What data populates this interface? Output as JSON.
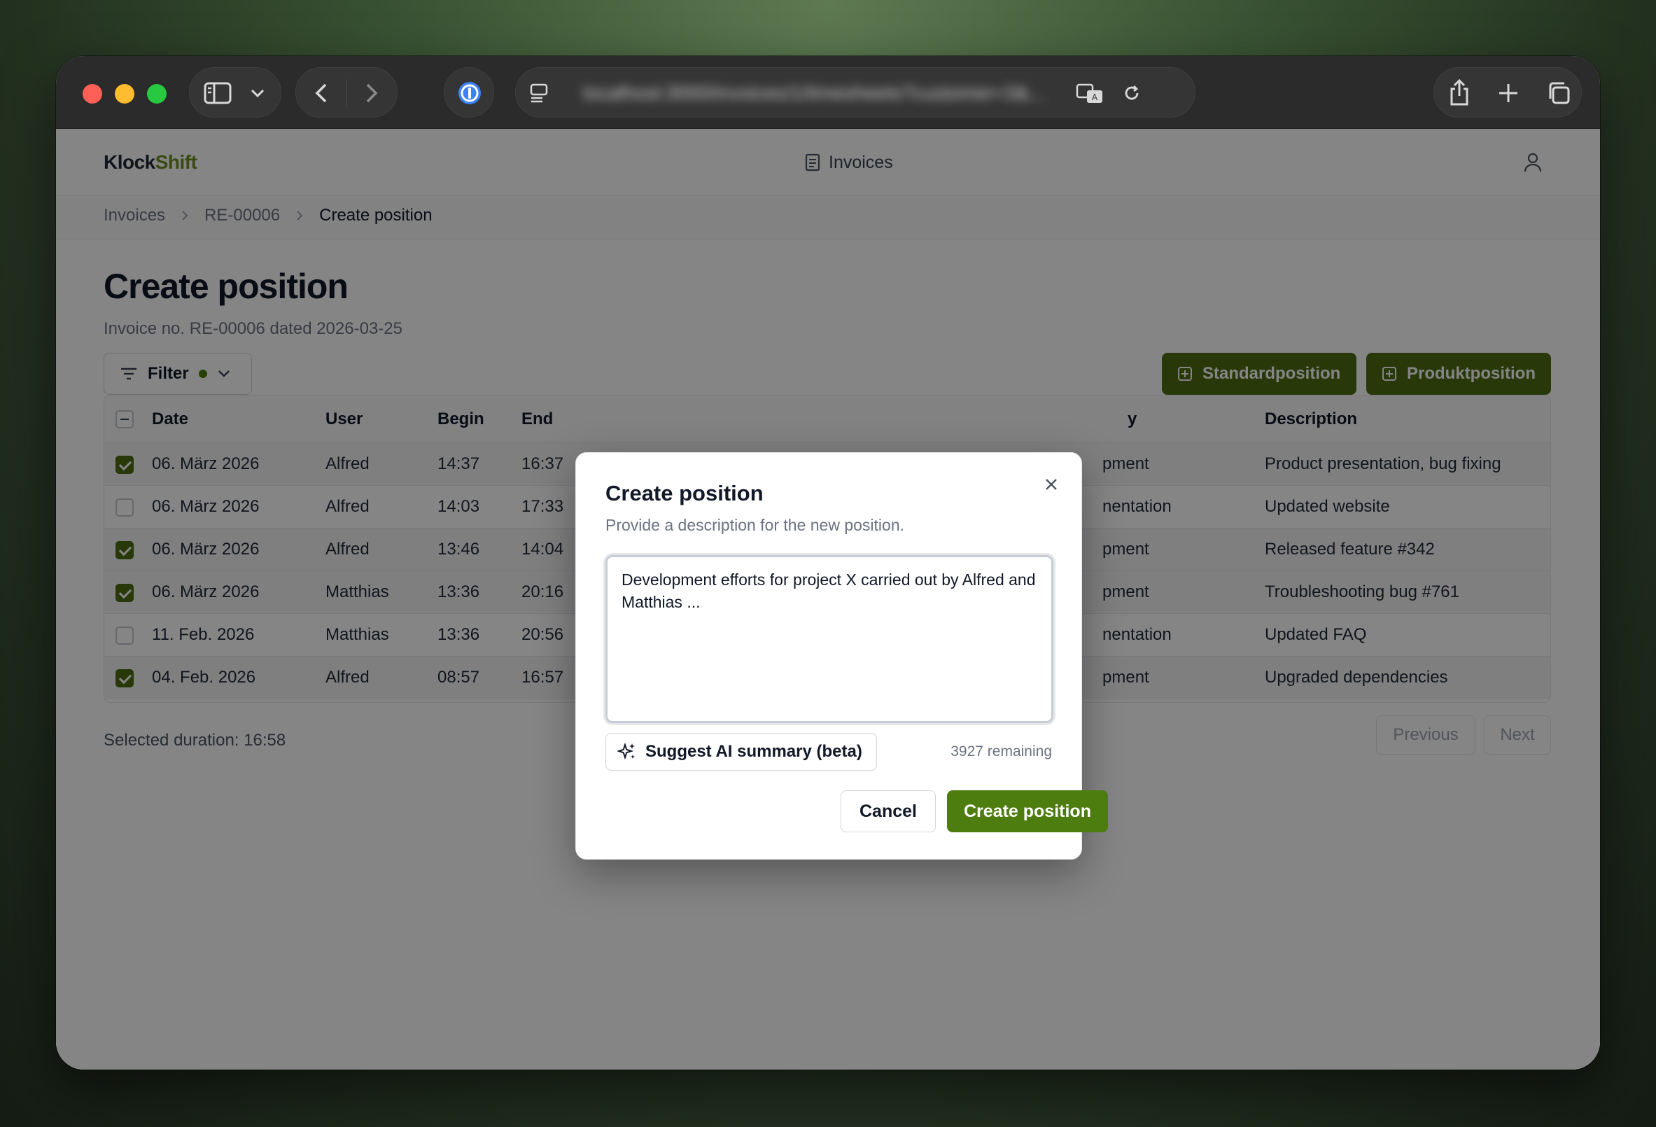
{
  "browser": {
    "url": "localhost:3000/invoices/1/timesheets?customer=3&..."
  },
  "app": {
    "logo_part1": "Klock",
    "logo_part2": "Shift",
    "nav_invoices": "Invoices",
    "accent": "#4d7c0f"
  },
  "breadcrumb": [
    "Invoices",
    "RE-00006",
    "Create position"
  ],
  "page": {
    "title": "Create position",
    "subtitle": "Invoice no. RE-00006 dated 2026-03-25",
    "filter_label": "Filter",
    "standard_btn": "Standardposition",
    "product_btn": "Produktposition"
  },
  "table": {
    "headers": [
      "Date",
      "User",
      "Begin",
      "End",
      "y",
      "Description"
    ],
    "rows": [
      {
        "checked": true,
        "date": "06. März 2026",
        "user": "Alfred",
        "begin": "14:37",
        "end": "16:37",
        "category": "pment",
        "description": "Product presentation, bug fixing"
      },
      {
        "checked": false,
        "date": "06. März 2026",
        "user": "Alfred",
        "begin": "14:03",
        "end": "17:33",
        "category": "nentation",
        "description": "Updated website"
      },
      {
        "checked": true,
        "date": "06. März 2026",
        "user": "Alfred",
        "begin": "13:46",
        "end": "14:04",
        "category": "pment",
        "description": "Released feature #342"
      },
      {
        "checked": true,
        "date": "06. März 2026",
        "user": "Matthias",
        "begin": "13:36",
        "end": "20:16",
        "category": "pment",
        "description": "Troubleshooting bug #761"
      },
      {
        "checked": false,
        "date": "11. Feb. 2026",
        "user": "Matthias",
        "begin": "13:36",
        "end": "20:56",
        "category": "nentation",
        "description": "Updated FAQ"
      },
      {
        "checked": true,
        "date": "04. Feb. 2026",
        "user": "Alfred",
        "begin": "08:57",
        "end": "16:57",
        "category": "pment",
        "description": "Upgraded dependencies"
      }
    ]
  },
  "footer": {
    "selected_duration": "Selected duration: 16:58",
    "previous": "Previous",
    "next": "Next"
  },
  "dialog": {
    "title": "Create position",
    "description": "Provide a description for the new position.",
    "textarea_value": "Development efforts for project X carried out by Alfred and Matthias ...",
    "ai_button": "Suggest AI summary (beta)",
    "remaining": "3927 remaining",
    "cancel": "Cancel",
    "create": "Create position"
  }
}
